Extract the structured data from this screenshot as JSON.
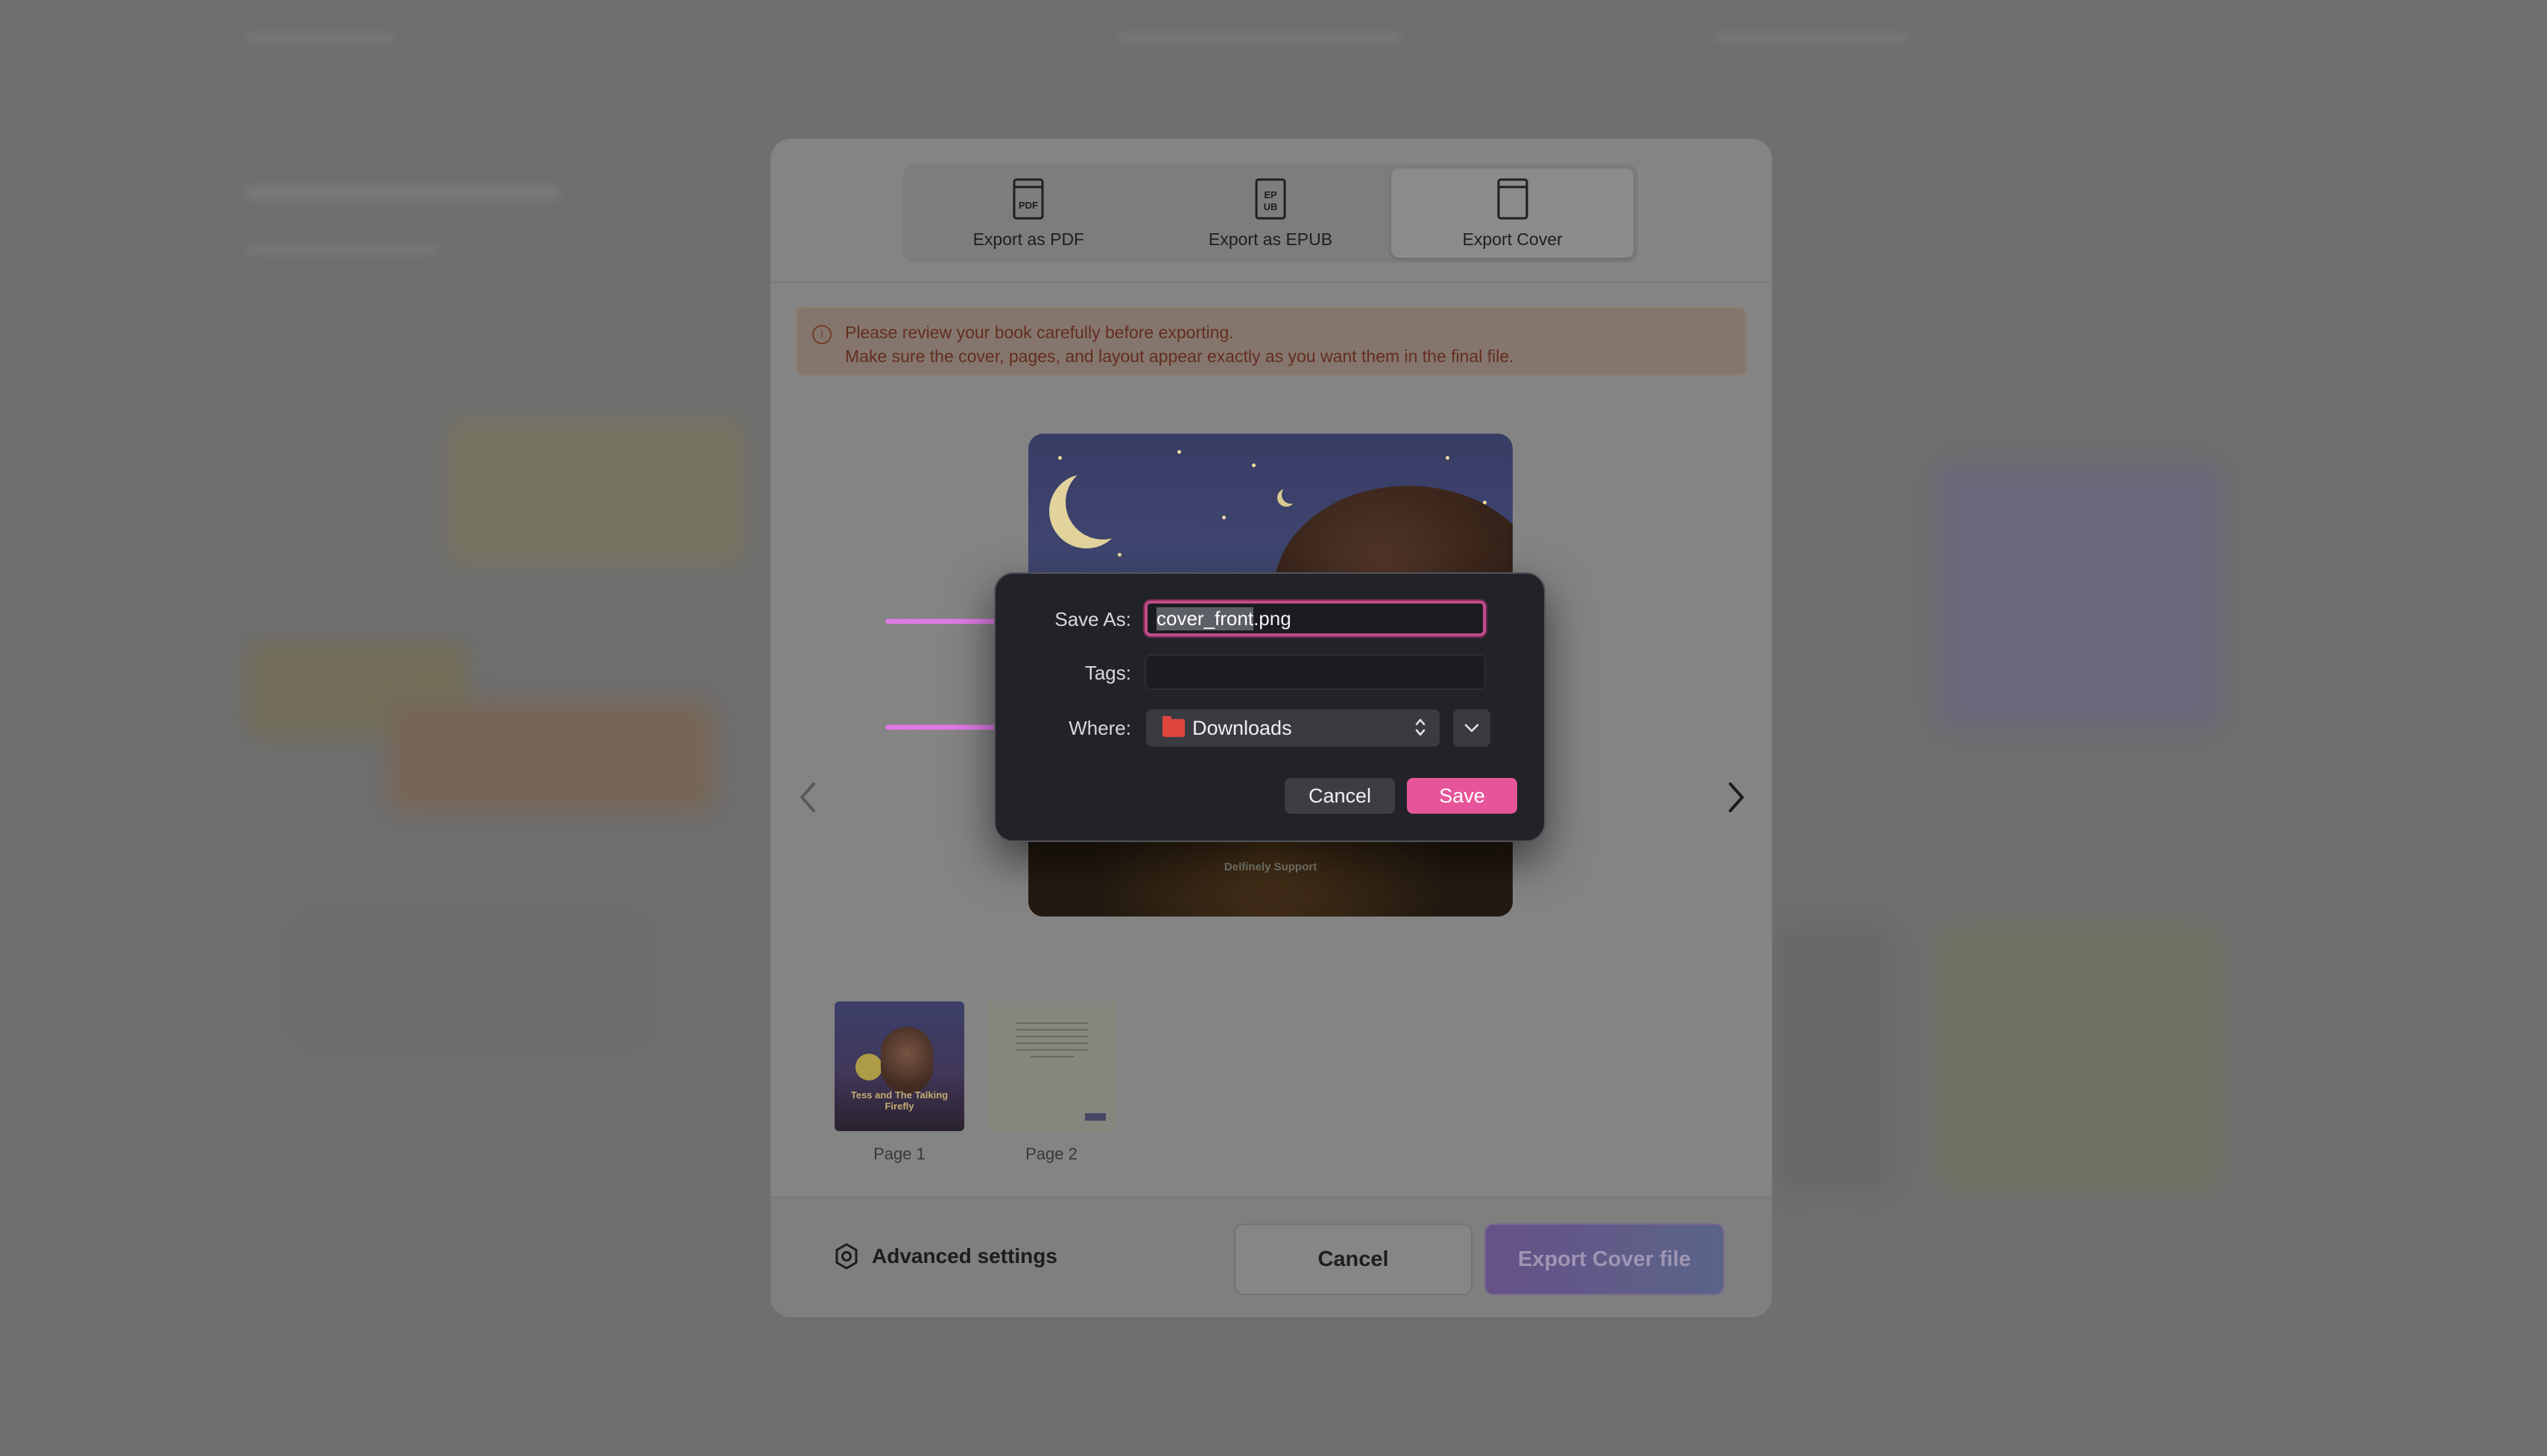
{
  "export_modal": {
    "tabs": [
      {
        "label": "Export as PDF",
        "icon": "pdf-file-icon",
        "icon_text": "PDF",
        "active": false
      },
      {
        "label": "Export as EPUB",
        "icon": "epub-file-icon",
        "icon_text_top": "EP",
        "icon_text_bottom": "UB",
        "active": false
      },
      {
        "label": "Export Cover",
        "icon": "cover-page-icon",
        "active": true
      }
    ],
    "notice": {
      "icon": "info-icon",
      "line1": "Please review your book carefully before exporting.",
      "line2": "Make sure the cover, pages, and layout appear exactly as you want them in the final file."
    },
    "preview": {
      "cover_caption": "Delfinely Support",
      "prev_icon": "chevron-left-icon",
      "next_icon": "chevron-right-icon"
    },
    "pages": [
      {
        "label": "Page 1",
        "thumb_title": "Tess and The Talking Firefly"
      },
      {
        "label": "Page 2"
      }
    ],
    "footer": {
      "advanced_settings": "Advanced settings",
      "advanced_icon": "gear-icon",
      "cancel": "Cancel",
      "export": "Export Cover file"
    }
  },
  "save_dialog": {
    "save_as_label": "Save As:",
    "filename_selected": "cover_front",
    "filename_ext": ".png",
    "tags_label": "Tags:",
    "tags_value": "",
    "where_label": "Where:",
    "where_value": "Downloads",
    "cancel": "Cancel",
    "save": "Save"
  },
  "colors": {
    "accent_pink": "#e6559a",
    "focus_ring": "#c24b8a",
    "annotation_arrow": "#e07ae6",
    "folder": "#e0443f"
  }
}
